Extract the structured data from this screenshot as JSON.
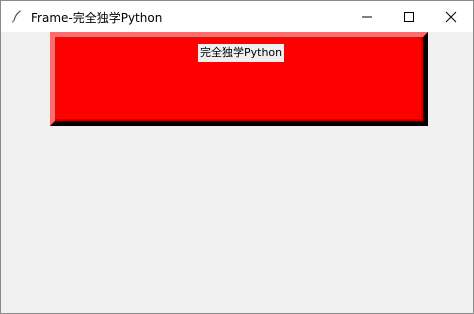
{
  "window": {
    "title": "Frame-完全独学Python",
    "icon": "feather-icon",
    "controls": {
      "minimize_icon": "minimize-icon",
      "maximize_icon": "maximize-icon",
      "close_icon": "close-icon"
    }
  },
  "frame": {
    "label": "完全独学Python",
    "colors": {
      "background": "#ff0000",
      "highlight": "#ff6b6b",
      "shadow": "#000000"
    }
  }
}
